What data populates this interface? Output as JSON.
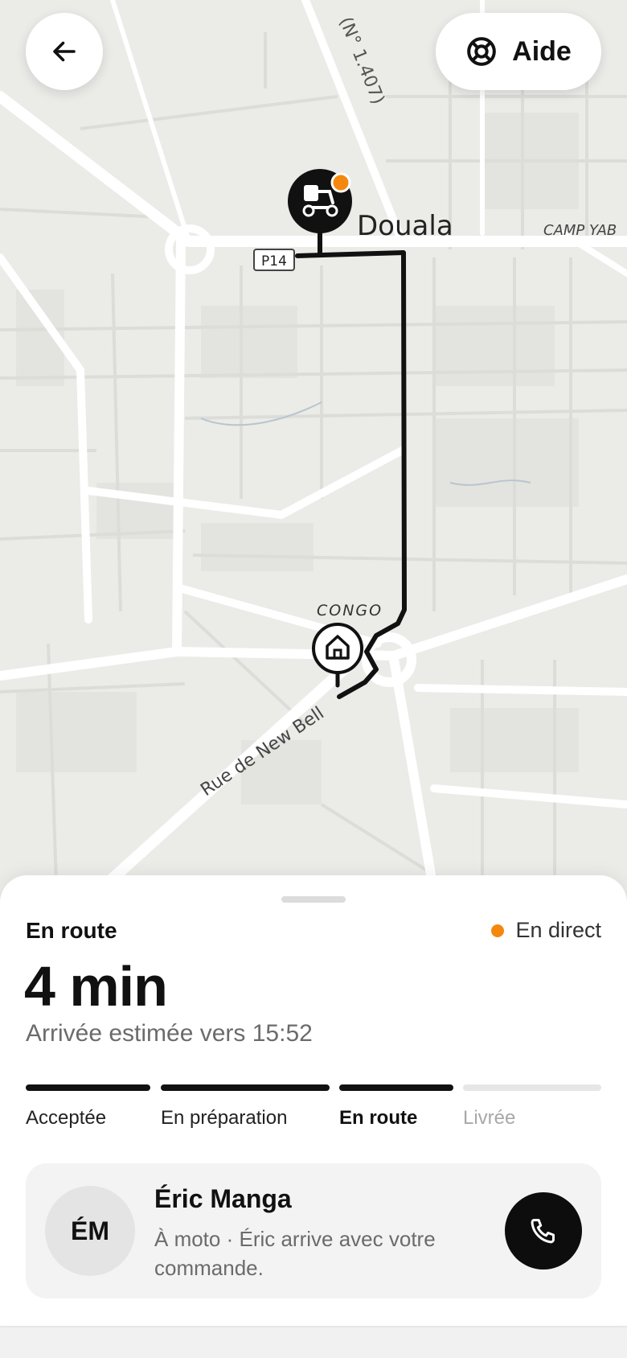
{
  "map": {
    "city_label": "Douala",
    "district_label": "CONGO",
    "area_label": "CAMP YAB",
    "street_label": "Rue de New Bell",
    "road_shield": "P14",
    "road_number": "(N° 1.407)",
    "courier_icon": "scooter-icon",
    "destination_icon": "home-icon",
    "route_color": "#111111",
    "courier_badge_color": "#f4880e"
  },
  "header": {
    "back_icon": "arrow-left-icon",
    "help_label": "Aide",
    "help_icon": "lifebuoy-icon"
  },
  "sheet": {
    "status_title": "En route",
    "live_label": "En direct",
    "live_color": "#f4880e",
    "eta_minutes": "4 min",
    "eta_text": "Arrivée estimée vers 15:52",
    "steps": [
      {
        "label": "Acceptée",
        "state": "done"
      },
      {
        "label": "En préparation",
        "state": "done"
      },
      {
        "label": "En route",
        "state": "current"
      },
      {
        "label": "Livrée",
        "state": "pending"
      }
    ],
    "driver": {
      "initials": "ÉM",
      "name": "Éric Manga",
      "description": "À moto · Éric arrive avec votre commande.",
      "call_icon": "phone-icon"
    }
  }
}
